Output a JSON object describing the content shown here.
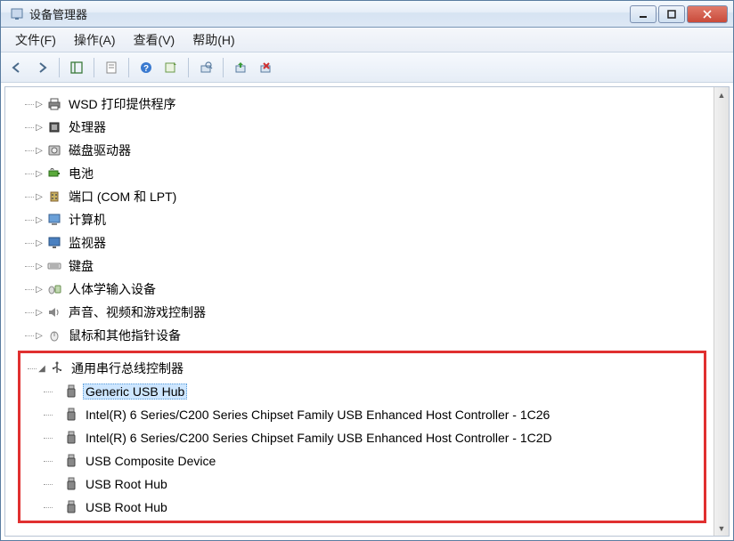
{
  "window": {
    "title": "设备管理器"
  },
  "menus": {
    "file": "文件(F)",
    "action": "操作(A)",
    "view": "查看(V)",
    "help": "帮助(H)"
  },
  "tree": {
    "items": [
      {
        "label": "WSD 打印提供程序",
        "icon": "printer"
      },
      {
        "label": "处理器",
        "icon": "cpu"
      },
      {
        "label": "磁盘驱动器",
        "icon": "disk"
      },
      {
        "label": "电池",
        "icon": "battery"
      },
      {
        "label": "端口 (COM 和 LPT)",
        "icon": "port"
      },
      {
        "label": "计算机",
        "icon": "computer"
      },
      {
        "label": "监视器",
        "icon": "monitor"
      },
      {
        "label": "键盘",
        "icon": "keyboard"
      },
      {
        "label": "人体学输入设备",
        "icon": "hid"
      },
      {
        "label": "声音、视频和游戏控制器",
        "icon": "sound"
      },
      {
        "label": "鼠标和其他指针设备",
        "icon": "mouse"
      }
    ],
    "usb_category": {
      "label": "通用串行总线控制器",
      "icon": "usb"
    },
    "usb_children": [
      {
        "label": "Generic USB Hub",
        "selected": true
      },
      {
        "label": "Intel(R) 6 Series/C200 Series Chipset Family USB Enhanced Host Controller - 1C26"
      },
      {
        "label": "Intel(R) 6 Series/C200 Series Chipset Family USB Enhanced Host Controller - 1C2D"
      },
      {
        "label": "USB Composite Device"
      },
      {
        "label": "USB Root Hub"
      },
      {
        "label": "USB Root Hub"
      }
    ]
  }
}
